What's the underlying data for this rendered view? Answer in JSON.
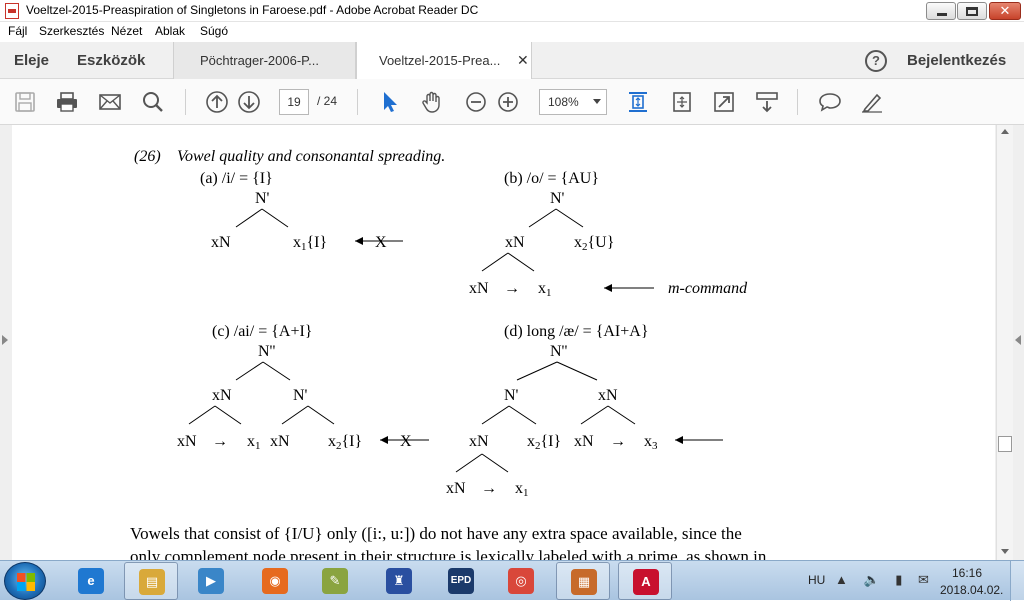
{
  "window": {
    "title": "Voeltzel-2015-Preaspiration of Singletons in Faroese.pdf - Adobe Acrobat Reader DC",
    "close_glyph": "✕"
  },
  "menu": {
    "items": [
      "Fájl",
      "Szerkesztés",
      "Nézet",
      "Ablak",
      "Súgó"
    ]
  },
  "nav": {
    "home": "Eleje",
    "tools": "Eszközök",
    "tabs": [
      {
        "label": "Pöchtrager-2006-P..."
      },
      {
        "label": "Voeltzel-2015-Prea...",
        "close": "✕"
      }
    ],
    "help": "?",
    "signin": "Bejelentkezés"
  },
  "toolbar": {
    "page_current": "19",
    "page_total": "/  24",
    "zoom": "108%",
    "icons": [
      "save-icon",
      "print-icon",
      "email-icon",
      "search-icon",
      "prev-page-icon",
      "next-page-icon",
      "select-tool-icon",
      "hand-tool-icon",
      "zoom-out-icon",
      "zoom-in-icon",
      "fit-page-icon",
      "rotate-icon",
      "fullscreen-icon",
      "scroll-mode-icon",
      "comment-icon",
      "highlight-icon"
    ]
  },
  "document": {
    "example_number": "(26)",
    "example_title": "Vowel quality and consonantal spreading.",
    "panels": {
      "a": {
        "label": "(a) /i/ = {I}",
        "root": "N'",
        "left": "xN",
        "right": "x",
        "right_sub": "1",
        "right_tail": "{I}",
        "blocked": "X"
      },
      "b": {
        "label": "(b) /o/ = {AU}",
        "root": "N'",
        "mid": "xN",
        "right": "x",
        "right_sub": "2",
        "right_tail": "{U}",
        "left_leaf": "xN",
        "arrow": "→",
        "right_leaf": "x",
        "right_leaf_sub": "1",
        "annotation": "m-command"
      },
      "c": {
        "label": "(c) /ai/ = {A+I}",
        "root": "N''",
        "left": "xN",
        "right": "N'",
        "l1": "xN",
        "arrow": "→",
        "l2": "x",
        "l2_sub": "1",
        "l3": "xN",
        "l4": "x",
        "l4_sub": "2",
        "l4_tail": "{I}",
        "blocked": "X"
      },
      "d": {
        "label": "(d) long /æ/ = {AI+A}",
        "root": "N''",
        "left": "N'",
        "right": "xN",
        "l1": "xN",
        "l2": "x",
        "l2_sub": "2",
        "l2_tail": "{I}",
        "l3": "xN",
        "arrow": "→",
        "l4": "x",
        "l4_sub": "3",
        "b1": "xN",
        "b2": "x",
        "b2_sub": "1"
      }
    },
    "body_line1": "Vowels that consist of {I/U} only ([i:, u:]) do not have any extra space available, since the",
    "body_line2": "only complement node present in their structure is lexically labeled with a prime, as shown in"
  },
  "taskbar": {
    "apps": [
      {
        "name": "internet-explorer",
        "glyph": "e",
        "color": "#1f78d1"
      },
      {
        "name": "file-explorer",
        "glyph": "▤",
        "color": "#d9a93a"
      },
      {
        "name": "media-player",
        "glyph": "▶",
        "color": "#3a86c8"
      },
      {
        "name": "firefox",
        "glyph": "◉",
        "color": "#e66a1e"
      },
      {
        "name": "paint",
        "glyph": "✎",
        "color": "#8aa440"
      },
      {
        "name": "app-blue",
        "glyph": "♜",
        "color": "#2a4fa0"
      },
      {
        "name": "epd",
        "glyph": "EPD",
        "color": "#1b3a6b"
      },
      {
        "name": "chrome",
        "glyph": "◎",
        "color": "#d9473a"
      },
      {
        "name": "presentation",
        "glyph": "▦",
        "color": "#c76a2a"
      },
      {
        "name": "acrobat",
        "glyph": "A",
        "color": "#c8102e"
      }
    ],
    "lang": "HU",
    "tray": "▲ 🔈 ▮ ✉",
    "time": "16:16",
    "date": "2018.04.02."
  }
}
